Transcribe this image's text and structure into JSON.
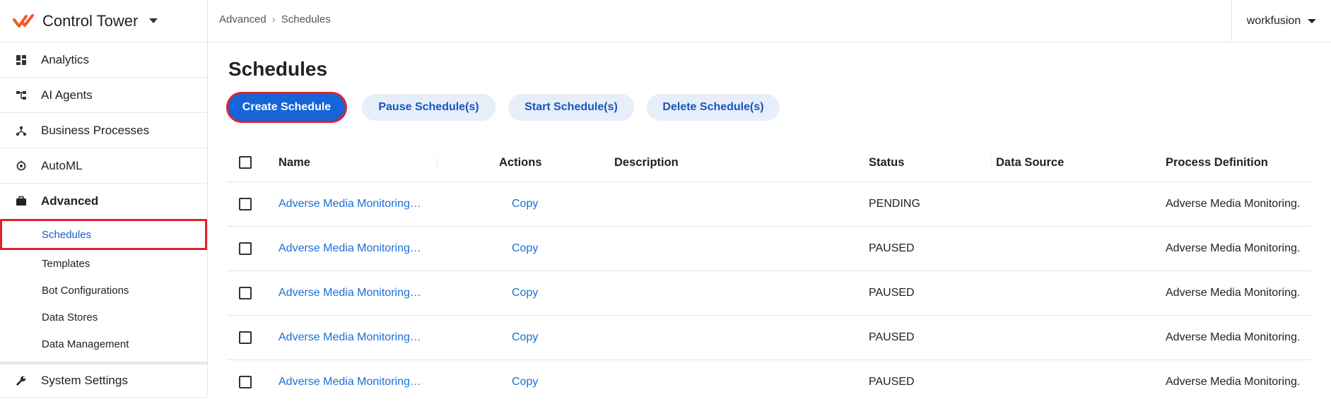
{
  "brand": {
    "title": "Control Tower"
  },
  "breadcrumb": {
    "parent": "Advanced",
    "current": "Schedules"
  },
  "user": {
    "name": "workfusion"
  },
  "sidebar": {
    "items": [
      {
        "label": "Analytics",
        "icon": "dashboard-icon"
      },
      {
        "label": "AI Agents",
        "icon": "hierarchy-icon"
      },
      {
        "label": "Business Processes",
        "icon": "process-icon"
      },
      {
        "label": "AutoML",
        "icon": "automl-icon"
      },
      {
        "label": "Advanced",
        "icon": "briefcase-icon"
      }
    ],
    "sub_items": [
      "Schedules",
      "Templates",
      "Bot Configurations",
      "Data Stores",
      "Data Management"
    ],
    "system": {
      "label": "System Settings",
      "icon": "wrench-icon"
    }
  },
  "page": {
    "title": "Schedules"
  },
  "toolbar": {
    "create": "Create Schedule",
    "pause": "Pause Schedule(s)",
    "start": "Start Schedule(s)",
    "delete": "Delete Schedule(s)"
  },
  "table": {
    "headers": [
      "Name",
      "Actions",
      "Description",
      "Status",
      "Data Source",
      "Process Definition"
    ],
    "rows": [
      {
        "name": "Adverse Media Monitoring…",
        "action": "Copy",
        "description": "",
        "status": "PENDING",
        "source": "",
        "process": "Adverse Media Monitoring."
      },
      {
        "name": "Adverse Media Monitoring…",
        "action": "Copy",
        "description": "",
        "status": "PAUSED",
        "source": "",
        "process": "Adverse Media Monitoring."
      },
      {
        "name": "Adverse Media Monitoring…",
        "action": "Copy",
        "description": "",
        "status": "PAUSED",
        "source": "",
        "process": "Adverse Media Monitoring."
      },
      {
        "name": "Adverse Media Monitoring…",
        "action": "Copy",
        "description": "",
        "status": "PAUSED",
        "source": "",
        "process": "Adverse Media Monitoring."
      },
      {
        "name": "Adverse Media Monitoring…",
        "action": "Copy",
        "description": "",
        "status": "PAUSED",
        "source": "",
        "process": "Adverse Media Monitoring."
      }
    ]
  },
  "colors": {
    "accent": "#1565d8",
    "highlight": "#e0222d",
    "link": "#1a6fd6",
    "logo": "#f05a28"
  }
}
